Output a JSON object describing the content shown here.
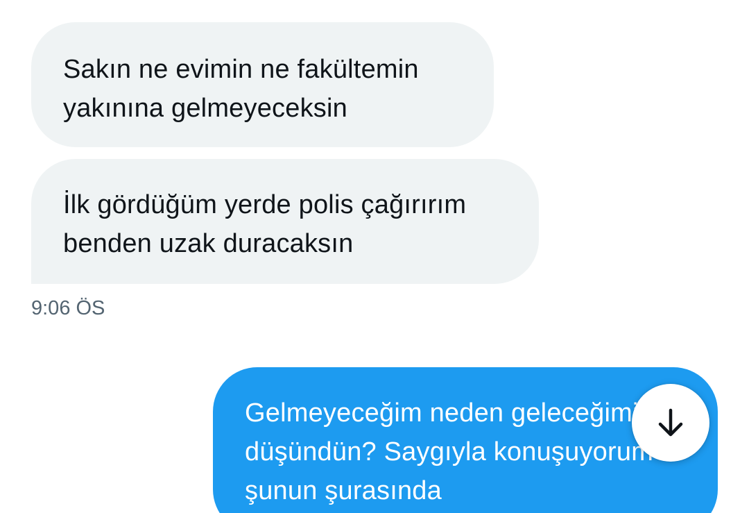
{
  "messages": {
    "incoming": [
      {
        "lines": [
          "Sakın ne evimin ne fakültemin",
          "yakınına gelmeyeceksin"
        ]
      },
      {
        "lines": [
          "İlk gördüğüm yerde polis çağırırım",
          "benden uzak duracaksın"
        ]
      }
    ],
    "incoming_timestamp": "9:06 ÖS",
    "outgoing": [
      {
        "lines": [
          "Gelmeyeceğim neden geleceğimi",
          "düşündün? Saygıyla konuşuyorum",
          "şunun şurasında"
        ]
      }
    ]
  },
  "colors": {
    "incoming_bubble": "#eff3f4",
    "outgoing_bubble": "#1d9bf0",
    "timestamp": "#536471"
  },
  "icons": {
    "scroll_down": "arrow-down-icon"
  }
}
